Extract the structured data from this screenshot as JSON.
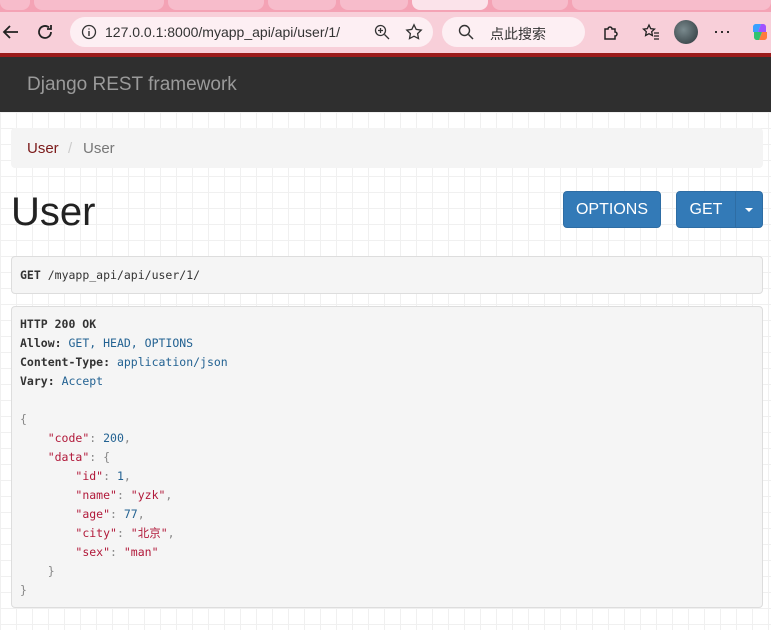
{
  "browser": {
    "url": "127.0.0.1:8000/myapp_api/api/user/1/",
    "search_placeholder": "点此搜索"
  },
  "navbar": {
    "brand": "Django REST framework"
  },
  "breadcrumb": [
    {
      "label": "User"
    },
    {
      "label": "User"
    }
  ],
  "page_title": "User",
  "buttons": {
    "options": "OPTIONS",
    "get": "GET"
  },
  "request": {
    "method": "GET",
    "path": "/myapp_api/api/user/1/"
  },
  "response": {
    "status": "HTTP 200 OK",
    "headers": [
      {
        "name": "Allow:",
        "value": "GET, HEAD, OPTIONS"
      },
      {
        "name": "Content-Type:",
        "value": "application/json"
      },
      {
        "name": "Vary:",
        "value": "Accept"
      }
    ],
    "body": {
      "code_key": "\"code\"",
      "code_val": "200",
      "data_key": "\"data\"",
      "fields": [
        {
          "key": "\"id\"",
          "value": "1",
          "kind": "n"
        },
        {
          "key": "\"name\"",
          "value": "\"yzk\"",
          "kind": "s"
        },
        {
          "key": "\"age\"",
          "value": "77",
          "kind": "n"
        },
        {
          "key": "\"city\"",
          "value": "\"北京\"",
          "kind": "s"
        },
        {
          "key": "\"sex\"",
          "value": "\"man\"",
          "kind": "s"
        }
      ]
    }
  },
  "colors": {
    "navbar": "#2f2f2f",
    "primary": "#337ab7",
    "link": "#7b1a1a",
    "json_key": "#b1193a",
    "json_value": "#236292"
  }
}
